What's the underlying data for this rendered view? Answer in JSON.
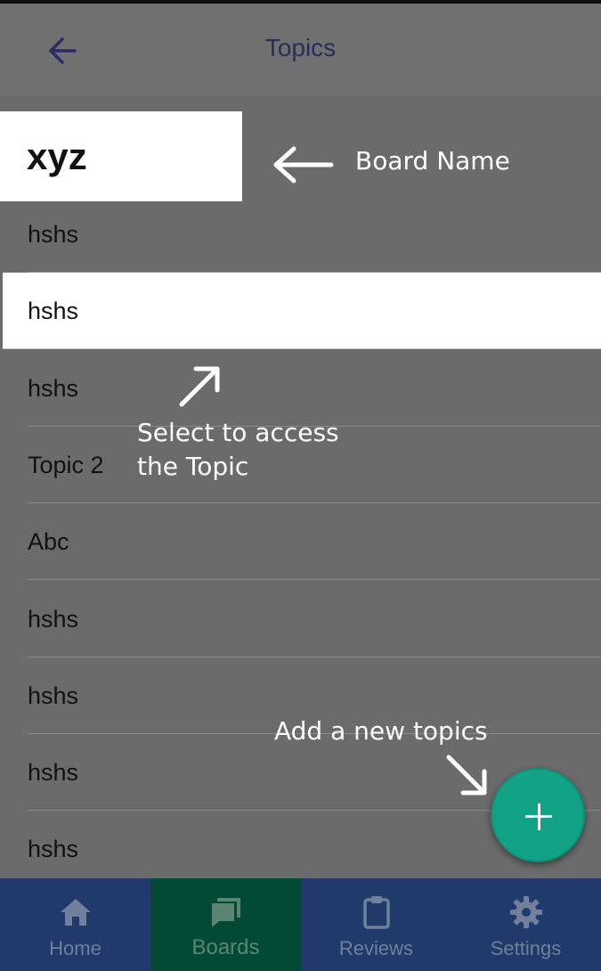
{
  "header": {
    "title": "Topics",
    "back_icon": "arrow-left-icon"
  },
  "board": {
    "name": "xyz"
  },
  "topics": [
    {
      "label": "hshs",
      "selected": false
    },
    {
      "label": "hshs",
      "selected": true
    },
    {
      "label": "hshs",
      "selected": false
    },
    {
      "label": "Topic 2",
      "selected": false
    },
    {
      "label": "Abc",
      "selected": false
    },
    {
      "label": "hshs",
      "selected": false
    },
    {
      "label": "hshs",
      "selected": false
    },
    {
      "label": "hshs",
      "selected": false
    },
    {
      "label": "hshs",
      "selected": false
    }
  ],
  "annotations": {
    "board_name": "Board Name",
    "select_line1": "Select to access",
    "select_line2": "the Topic",
    "add_topic": "Add a new topics"
  },
  "fab": {
    "icon": "plus-icon",
    "color": "#12a286"
  },
  "nav": [
    {
      "label": "Home",
      "icon": "home-icon",
      "active": false
    },
    {
      "label": "Boards",
      "icon": "boards-icon",
      "active": true
    },
    {
      "label": "Reviews",
      "icon": "clipboard-icon",
      "active": false
    },
    {
      "label": "Settings",
      "icon": "gear-icon",
      "active": false
    }
  ],
  "colors": {
    "nav_bg": "#1f3a6b",
    "nav_active": "#034a34",
    "overlay": "#6b6b6b"
  }
}
